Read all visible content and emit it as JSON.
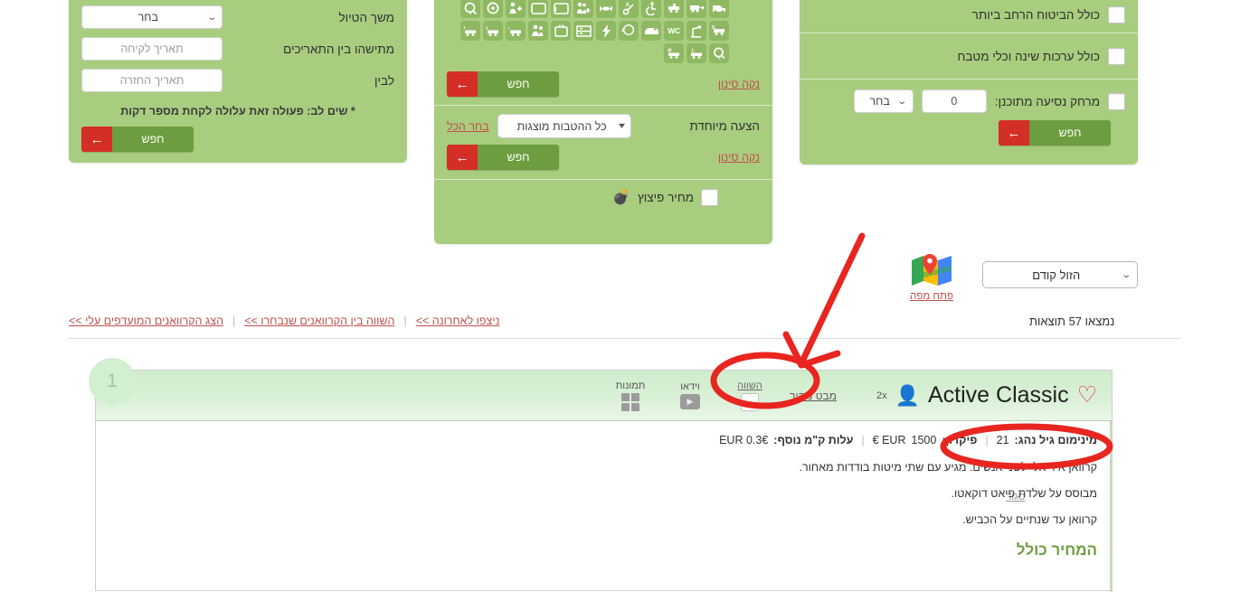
{
  "filters": {
    "trip": {
      "duration_label": "משך הטיול",
      "duration_value": "בחר",
      "between_label": "מתישהו בין התאריכים",
      "pickup_placeholder": "תאריך לקיחה",
      "to_label": "לבין",
      "return_placeholder": "תאריך החזרה",
      "note": "* שים לב: פעולה זאת עלולה לקחת מספר דקות",
      "search_label": "חפש"
    },
    "features": {
      "clear_label": "נקה סינון",
      "search_label": "חפש",
      "icons": [
        "van-icon",
        "caravan-arrow-icon",
        "caravan-scale-icon",
        "wheelchair-icon",
        "key-auto-icon",
        "length-icon",
        "family-plus-icon",
        "x3-icon",
        "2plus2-icon",
        "person-plus-icon",
        "steering-wheel-icon",
        "key-circle-icon",
        "caravan-s-icon",
        "crane-icon",
        "wc-icon",
        "mouse-van-icon",
        "4x4-icon",
        "power-icon",
        "bunk-beds-icon",
        "tv-icon",
        "family-icon",
        "new-icon",
        "age-0-3-icon",
        "plus4-icon",
        "key-c-icon",
        "caravan-l-icon",
        "caravan-m-icon"
      ]
    },
    "special_offer": {
      "label": "הצעה מיוחדת",
      "select_value": "כל ההטבות מוצגות",
      "select_all_label": "בחר הכל",
      "clear_label": "נקה סינון",
      "search_label": "חפש"
    },
    "blast_price": {
      "label": "מחיר פיצוץ",
      "icon": "bomb-icon"
    },
    "extras": {
      "insurance_label": "כולל הביטוח הרחב ביותר",
      "kitchen_label": "כולל ערכות שינה וכלי מטבח",
      "distance_label": "מרחק נסיעה מתוכנן:",
      "distance_value": "0",
      "distance_unit": "בחר",
      "search_label": "חפש"
    }
  },
  "toplinks": [
    "ניצפו לאחרונה >>",
    "השווה בין הקרוואנים שנבחרו >>",
    "הצג הקרוואנים המועדפים עלי >>"
  ],
  "results": {
    "sort_value": "הזול קודם",
    "map_link": "פתח מפה",
    "map_icon": "map-icon",
    "count_text": "נמצאו 57 תוצאות"
  },
  "card": {
    "badge": "1",
    "title": "Active Classic",
    "favorite_icon": "heart-icon",
    "pax": "2x",
    "pax_icon": "person-icon",
    "quick_view": "מבט מהיר",
    "compare_label": "השווה",
    "video_label": "וידאו",
    "photos_label": "תמונות",
    "expand_icon": "chevron-down-icon",
    "close_label": "סגור",
    "specs": {
      "min_age_label": "מינימום גיל נהג:",
      "min_age_value": "21",
      "deposit_label": "פיקדון:",
      "deposit_value": "1500",
      "deposit_currency": "EUR €",
      "km_label": "עלות ק\"מ נוסף:",
      "km_value": "EUR 0.3€"
    },
    "description": [
      "קרוואן אידיאלי לשני אנשים. מגיע עם שתי מיטות בודדות מאחור.",
      "מבוסס על שלדת פיאט דוקאטו.",
      "קרוואן עד שנתיים על הכביש."
    ],
    "price_title": "המחיר כולל"
  },
  "colors": {
    "panel_green": "#a9cd7f",
    "button_green": "#6d9d3e",
    "accent_red": "#d32f27",
    "link_red": "#c0504d",
    "annotation_red": "#e8251f"
  }
}
